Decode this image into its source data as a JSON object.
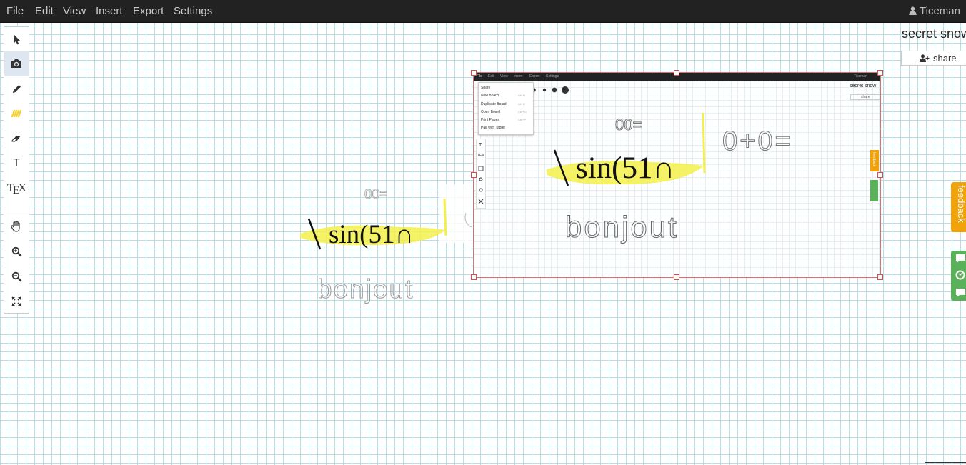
{
  "menubar": {
    "items": [
      {
        "label": "File"
      },
      {
        "label": "Edit"
      },
      {
        "label": "View"
      },
      {
        "label": "Insert"
      },
      {
        "label": "Export"
      },
      {
        "label": "Settings"
      }
    ],
    "user": "Ticeman"
  },
  "toolbar": {
    "tools": [
      {
        "name": "select",
        "icon": "cursor-arrow-icon",
        "active": false
      },
      {
        "name": "image",
        "icon": "camera-icon",
        "active": true
      },
      {
        "name": "pen",
        "icon": "pencil-icon",
        "active": false
      },
      {
        "name": "highlighter",
        "icon": "highlighter-icon",
        "active": false
      },
      {
        "name": "eraser",
        "icon": "eraser-icon",
        "active": false
      },
      {
        "name": "text",
        "icon": "text-icon",
        "active": false,
        "glyph": "T"
      },
      {
        "name": "latex",
        "icon": "tex-icon",
        "active": false,
        "glyph": "TEX"
      },
      {
        "name": "pan",
        "icon": "hand-icon",
        "active": false
      },
      {
        "name": "zoom-in",
        "icon": "zoom-in-icon",
        "active": false
      },
      {
        "name": "zoom-out",
        "icon": "zoom-out-icon",
        "active": false
      },
      {
        "name": "fit",
        "icon": "expand-icon",
        "active": false
      }
    ]
  },
  "panel": {
    "title": "secret snow",
    "share_label": "share",
    "feedback_label": "feedback"
  },
  "canvas": {
    "formula": "\\ sin(51∩",
    "scribble_top": "00=",
    "scribble_word": "bonjout",
    "scribble_equation": "0+0="
  },
  "embedded_screenshot": {
    "menu": [
      "File",
      "Edit",
      "View",
      "Insert",
      "Export",
      "Settings"
    ],
    "user": "Ticeman",
    "file_menu_items": [
      {
        "label": "Share",
        "shortcut": ""
      },
      {
        "label": "New Board",
        "shortcut": "Alt+N"
      },
      {
        "label": "Duplicate Board",
        "shortcut": "Alt+D"
      },
      {
        "label": "Open Board",
        "shortcut": "Ctrl+O"
      },
      {
        "label": "Print Pages",
        "shortcut": "Ctrl+P"
      },
      {
        "label": "Pair with Tablet",
        "shortcut": ""
      }
    ],
    "title": "secret snow",
    "share_label": "share",
    "feedback_label": "feedback"
  },
  "colors": {
    "menubar": "#222222",
    "grid": "#b7dde6",
    "highlight": "#f4f04a",
    "selection": "#e26b6b",
    "feedback": "#f0a30a",
    "chat": "#59b259",
    "active_tool": "#dde6f1"
  }
}
